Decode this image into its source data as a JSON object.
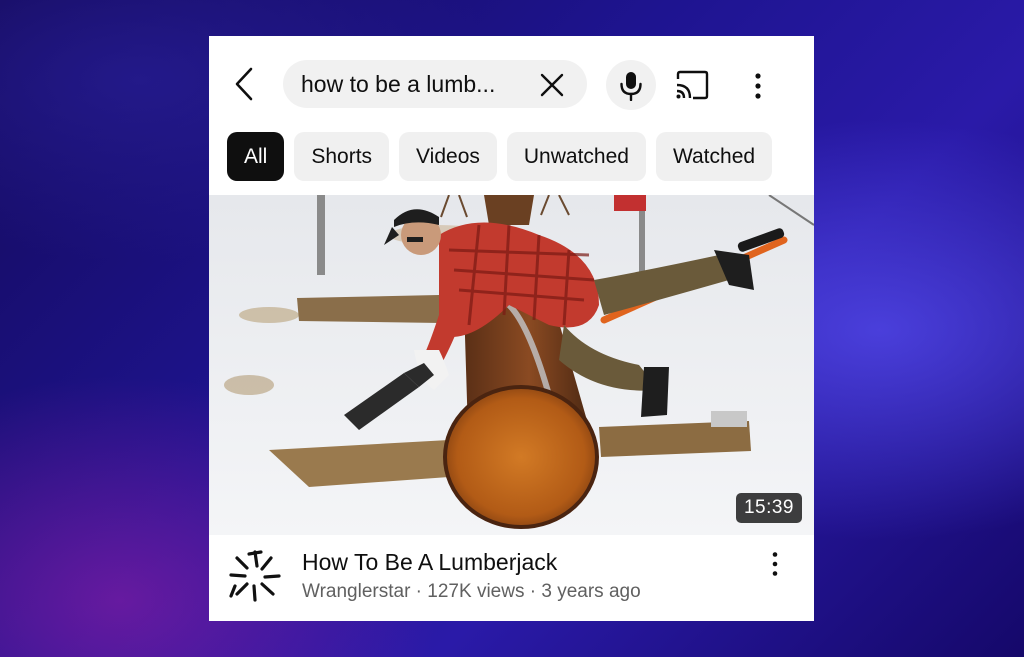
{
  "search": {
    "query": "how to be a lumb..."
  },
  "chips": [
    "All",
    "Shorts",
    "Videos",
    "Unwatched",
    "Watched"
  ],
  "video": {
    "duration": "15:39",
    "title": "How To Be A Lumberjack",
    "channel": "Wranglerstar",
    "views": "127K views",
    "age": "3 years ago",
    "separator": " · "
  },
  "icons": {
    "back": "chevron-left-icon",
    "clear": "close-icon",
    "mic": "microphone-icon",
    "cast": "cast-icon",
    "more": "more-vertical-icon"
  },
  "colors": {
    "active_chip": "#0f0f0f",
    "chip_bg": "#f0f0f0",
    "secondary_text": "#606060"
  }
}
